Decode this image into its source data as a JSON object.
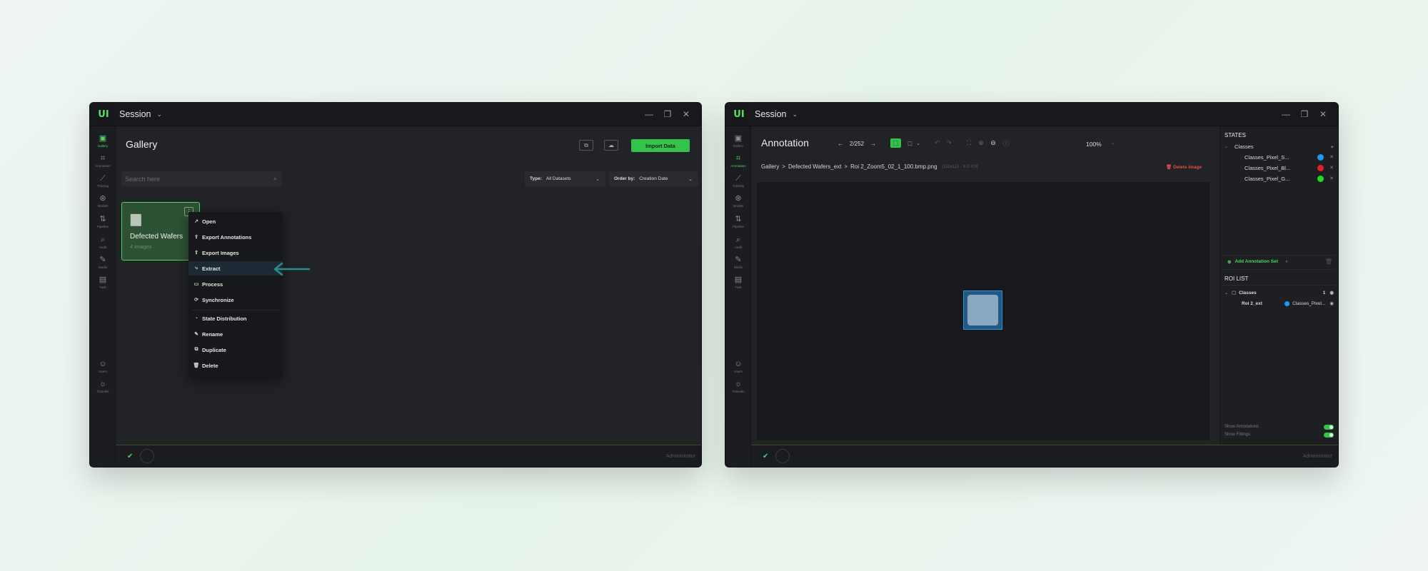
{
  "colors": {
    "accent": "#35c24b",
    "danger": "#e24848",
    "class_blue": "#2196f3",
    "class_red": "#e52020",
    "class_green": "#1fdc22"
  },
  "nav": [
    {
      "label": "Gallery",
      "icon": "image-icon"
    },
    {
      "label": "Annotation",
      "icon": "crop-icon"
    },
    {
      "label": "Training",
      "icon": "trend-icon"
    },
    {
      "label": "Models",
      "icon": "model-icon"
    },
    {
      "label": "Pipeline",
      "icon": "pipeline-icon"
    },
    {
      "label": "Audit",
      "icon": "audit-icon"
    },
    {
      "label": "Studio",
      "icon": "wand-icon"
    },
    {
      "label": "Task",
      "icon": "clipboard-icon"
    },
    {
      "label": "Users",
      "icon": "user-icon"
    },
    {
      "label": "Tutorials",
      "icon": "bulb-icon"
    }
  ],
  "left_window": {
    "session": "Session",
    "title": "Gallery",
    "import_label": "Import Data",
    "search_placeholder": "Search here",
    "type_label": "Type:",
    "type_value": "All Datasets",
    "order_label": "Order by:",
    "order_value": "Creation Date",
    "card_title": "Defected Wafers",
    "card_sub": "4 images",
    "menu": [
      "Open",
      "Export Annotations",
      "Export Images",
      "Extract",
      "Process",
      "Synchronize",
      "State Distribution",
      "Rename",
      "Duplicate",
      "Delete"
    ],
    "status_user": "Administrator"
  },
  "right_window": {
    "session": "Session",
    "title": "Annotation",
    "pager": "2/252",
    "zoom": "100%",
    "breadcrumb": [
      "Gallery",
      ">",
      "Defected Wafers_ext",
      ">",
      "Roi 2_Zoom5_02_1_100.bmp.png"
    ],
    "image_info": "(111x113 - X:0 Y:0)",
    "delete_image": "Delete Image",
    "states_title": "STATES",
    "classes_label": "Classes",
    "states": [
      "Classes_Pixel_S...",
      "Classes_Pixel_Bl...",
      "Classes_Pixel_G..."
    ],
    "add_annotation_set": "Add Annotation Set",
    "roi_title": "ROI LIST",
    "roi_group": "Classes",
    "roi_count": "1",
    "roi_item": "Roi 2_ext",
    "roi_item_class": "Classes_Pixel...",
    "show_annotations": "Show Annotations",
    "show_fittings": "Show Fittings",
    "status_user": "Administrator"
  }
}
